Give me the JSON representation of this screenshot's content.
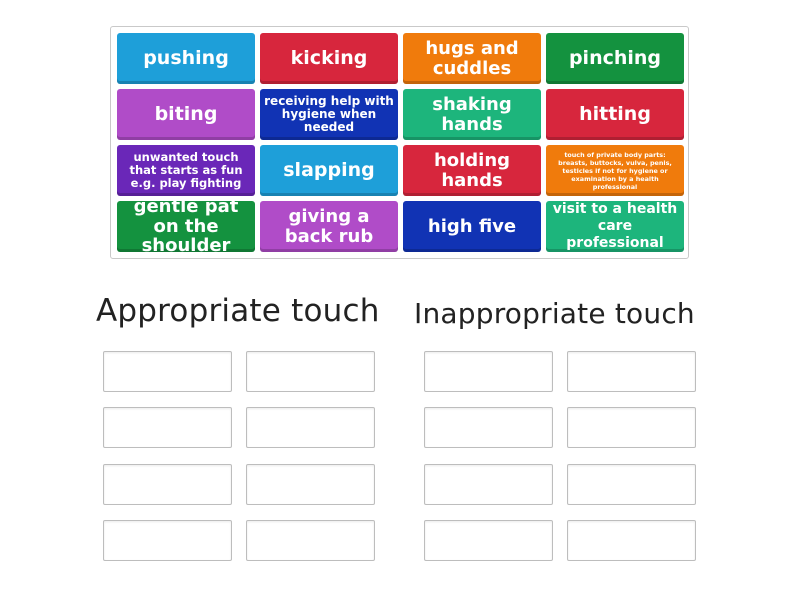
{
  "colors": {
    "blue": "#1e9fd9",
    "red": "#d7263d",
    "orange": "#f07b0c",
    "green": "#14923f",
    "purple": "#b04cc8",
    "navy": "#1133b4",
    "teal": "#1db57c",
    "violet": "#6a27b8"
  },
  "tiles": [
    {
      "label": "pushing",
      "color": "#1e9fd9"
    },
    {
      "label": "kicking",
      "color": "#d7263d"
    },
    {
      "label": "hugs and cuddles",
      "color": "#f07b0c"
    },
    {
      "label": "pinching",
      "color": "#14923f"
    },
    {
      "label": "biting",
      "color": "#b04cc8"
    },
    {
      "label": "receiving help with hygiene when needed",
      "color": "#1133b4"
    },
    {
      "label": "shaking hands",
      "color": "#1db57c"
    },
    {
      "label": "hitting",
      "color": "#d7263d"
    },
    {
      "label": "unwanted touch that starts as fun e.g. play fighting",
      "color": "#6a27b8"
    },
    {
      "label": "slapping",
      "color": "#1e9fd9"
    },
    {
      "label": "holding hands",
      "color": "#d7263d"
    },
    {
      "label": "touch of private body parts: breasts, buttocks, vulva, penis, testicles if not for hygiene or examination by a health professional",
      "color": "#f07b0c"
    },
    {
      "label": "gentle pat on the shoulder",
      "color": "#14923f"
    },
    {
      "label": "giving a back rub",
      "color": "#b04cc8"
    },
    {
      "label": "high five",
      "color": "#1133b4"
    },
    {
      "label": "visit to a health care professional",
      "color": "#1db57c"
    }
  ],
  "groups": [
    {
      "title": "Appropriate touch"
    },
    {
      "title": "Inappropriate touch"
    }
  ]
}
